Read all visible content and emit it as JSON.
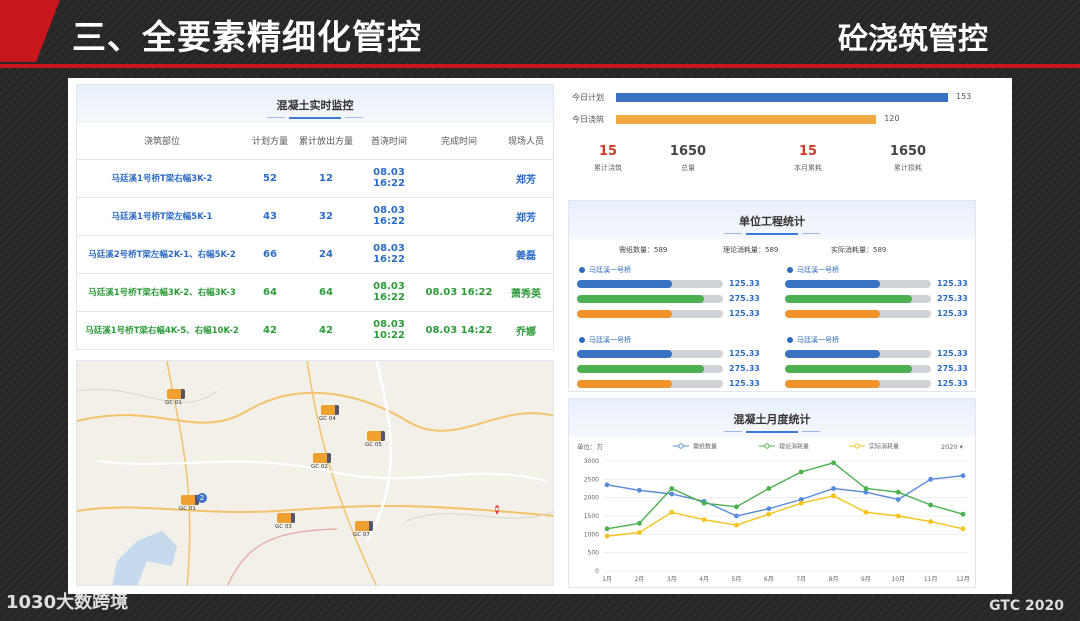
{
  "header": {
    "title": "三、全要素精细化管控",
    "section": "砼浇筑管控",
    "accent": "#c8161d"
  },
  "monitor": {
    "title": "混凝土实时监控",
    "columns": [
      "浇筑部位",
      "计划方量",
      "累计放出方量",
      "首浇时间",
      "完成时间",
      "现场人员"
    ],
    "rows": [
      {
        "location": "马廷溪1号桥T梁右幅3K-2",
        "plan": "52",
        "cumulative": "12",
        "start": "08.03 16:22",
        "end": "",
        "staff": "郑芳",
        "status": "blue"
      },
      {
        "location": "马廷溪1号桥T梁左幅5K-1",
        "plan": "43",
        "cumulative": "32",
        "start": "08.03 16:22",
        "end": "",
        "staff": "郑芳",
        "status": "blue"
      },
      {
        "location": "马廷溪2号桥T梁左幅2K-1、右幅5K-2",
        "plan": "66",
        "cumulative": "24",
        "start": "08.03 16:22",
        "end": "",
        "staff": "姜磊",
        "status": "blue"
      },
      {
        "location": "马廷溪1号桥T梁右幅3K-2、右幅3K-3",
        "plan": "64",
        "cumulative": "64",
        "start": "08.03 16:22",
        "end": "08.03 16:22",
        "staff": "萧秀英",
        "status": "green"
      },
      {
        "location": "马廷溪1号桥T梁右幅4K-5、右幅10K-2",
        "plan": "42",
        "cumulative": "42",
        "start": "08.03 10:22",
        "end": "08.03 14:22",
        "staff": "乔娜",
        "status": "green"
      }
    ]
  },
  "map": {
    "trucks": [
      "GC 01",
      "GC 04",
      "GC 05",
      "GC 02",
      "GC 01",
      "GC 03",
      "GC 07"
    ],
    "badge": "2"
  },
  "today": {
    "plan_label": "今日计划",
    "plan_value": "153",
    "pour_label": "今日浇筑",
    "pour_value": "120",
    "plan_fraction": 1.0,
    "pour_fraction": 0.784,
    "kpis": [
      {
        "value": "15",
        "caption": "累计浇筑",
        "color": "#d23a2a"
      },
      {
        "value": "1650",
        "caption": "总量",
        "color": "#444444"
      },
      {
        "value": "15",
        "caption": "本月累耗",
        "color": "#d23a2a"
      },
      {
        "value": "1650",
        "caption": "累计损耗",
        "color": "#444444"
      }
    ]
  },
  "unit": {
    "title": "单位工程统计",
    "summary": [
      "需纸数量：589",
      "理论消耗量：589",
      "实际消耗量：589"
    ],
    "groups": [
      {
        "name": "马廷溪一号桥",
        "values": [
          "125.33",
          "275.33",
          "125.33"
        ]
      },
      {
        "name": "马廷溪一号桥",
        "values": [
          "125.33",
          "275.33",
          "125.33"
        ]
      },
      {
        "name": "马廷溪一号桥",
        "values": [
          "125.33",
          "275.33",
          "125.33"
        ]
      },
      {
        "name": "马廷溪一号桥",
        "values": [
          "125.33",
          "275.33",
          "125.33"
        ]
      }
    ],
    "bar_fractions": [
      0.65,
      0.87,
      0.65
    ],
    "bar_colors": [
      "#3a72c4",
      "#4caf50",
      "#f0932b"
    ]
  },
  "monthly": {
    "title": "混凝土月度统计",
    "unit_label": "单位：方",
    "year": "2020 ▾"
  },
  "chart_data": {
    "type": "line",
    "title": "混凝土月度统计",
    "categories": [
      "1月",
      "2月",
      "3月",
      "4月",
      "5月",
      "6月",
      "7月",
      "8月",
      "9月",
      "10月",
      "11月",
      "12月"
    ],
    "ylim": [
      0,
      3000
    ],
    "yticks": [
      0,
      500,
      1000,
      1500,
      2000,
      2500,
      3000
    ],
    "legend_position": "top",
    "series": [
      {
        "name": "需纸数量",
        "color": "#5b8bd8",
        "values": [
          2350,
          2200,
          2100,
          1900,
          1500,
          1700,
          1950,
          2250,
          2150,
          1950,
          2500,
          2600
        ]
      },
      {
        "name": "理论消耗量",
        "color": "#4caf50",
        "values": [
          1150,
          1300,
          2250,
          1850,
          1750,
          2250,
          2700,
          2950,
          2250,
          2150,
          1800,
          1550
        ]
      },
      {
        "name": "实际消耗量",
        "color": "#f0c419",
        "values": [
          950,
          1050,
          1600,
          1400,
          1250,
          1550,
          1850,
          2050,
          1600,
          1500,
          1350,
          1150
        ]
      }
    ]
  },
  "footer": {
    "watermark": "1030大数跨境",
    "event": "GTC 2020"
  }
}
